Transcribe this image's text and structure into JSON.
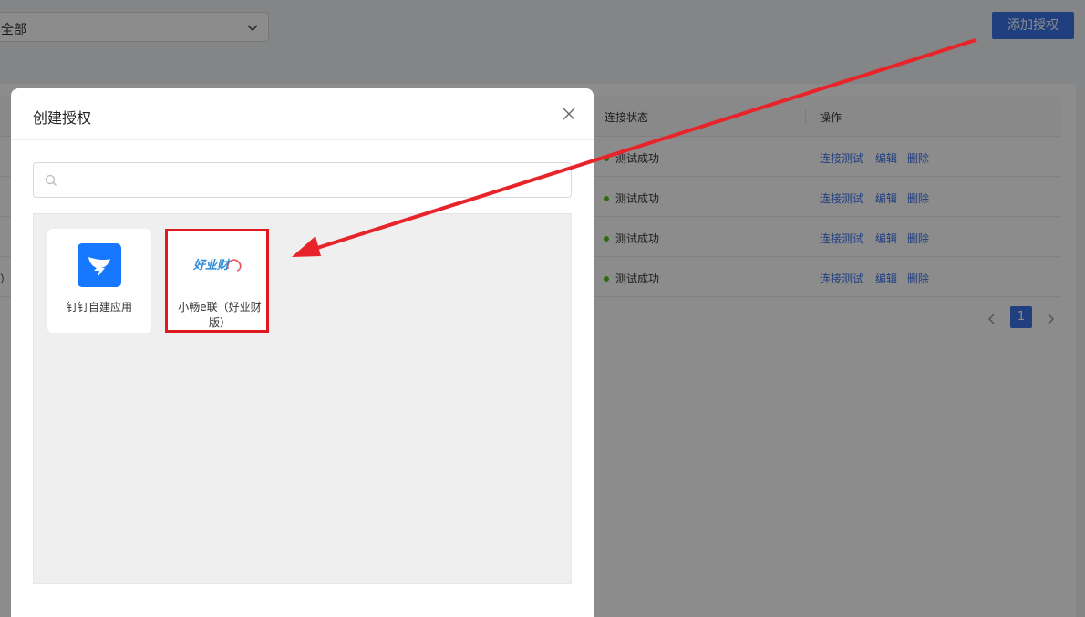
{
  "filter": {
    "value": "全部"
  },
  "header": {
    "add_button": "添加授权"
  },
  "table": {
    "columns": {
      "status": "连接状态",
      "actions": "操作"
    },
    "rows": [
      {
        "status": "测试成功",
        "trunc": ""
      },
      {
        "status": "测试成功",
        "trunc": ""
      },
      {
        "status": "测试成功",
        "trunc": ""
      },
      {
        "status": "测试成功",
        "trunc": "）"
      }
    ],
    "actions": {
      "test": "连接测试",
      "edit": "编辑",
      "delete": "删除"
    },
    "status_color": "#52c41a"
  },
  "pagination": {
    "current": "1"
  },
  "modal": {
    "title": "创建授权",
    "search": {
      "placeholder": "",
      "value": ""
    },
    "apps": [
      {
        "label": "钉钉自建应用",
        "icon": "dingtalk-icon"
      },
      {
        "label": "小畅e联（好业财版）",
        "icon": "haoyecai-logo",
        "logo_text": "好业财"
      }
    ]
  },
  "colors": {
    "primary": "#3b73e8",
    "highlight": "#e0191f"
  }
}
